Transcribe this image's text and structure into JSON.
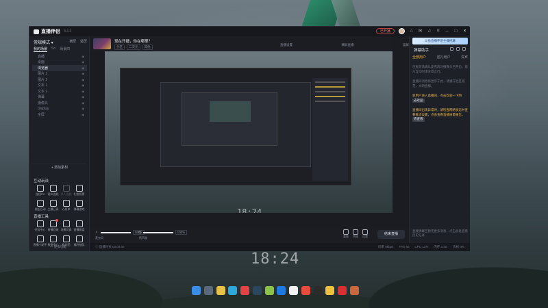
{
  "desktop": {
    "clock": "18:24",
    "taskbar_icons": [
      {
        "name": "windows-start-icon",
        "color": "#3a8ee6"
      },
      {
        "name": "taskview-icon",
        "color": "#5a6a7a"
      },
      {
        "name": "file-explorer-icon",
        "color": "#e8c14a"
      },
      {
        "name": "edge-icon",
        "color": "#2fa7d8"
      },
      {
        "name": "app-red-icon",
        "color": "#e24444"
      },
      {
        "name": "steam-icon",
        "color": "#2a475e"
      },
      {
        "name": "app-green-icon",
        "color": "#8bc34a"
      },
      {
        "name": "kugou-icon",
        "color": "#1f7ae0"
      },
      {
        "name": "app-white-icon",
        "color": "#f1f1f1"
      },
      {
        "name": "chrome-icon",
        "color": "#e84c3d"
      },
      {
        "name": "qq-icon",
        "color": "#2b2b2b"
      },
      {
        "name": "app-yellow-icon",
        "color": "#f0c040"
      },
      {
        "name": "netease-music-icon",
        "color": "#d93030"
      },
      {
        "name": "app-avatar-icon",
        "color": "#c9683c"
      }
    ]
  },
  "window": {
    "app_name": "直播伴侣",
    "version": "8.4.3",
    "live_status": "已开播",
    "accent": "#f0b84a"
  },
  "left": {
    "mode": "常规模式 ▾",
    "mode_ops": [
      "横屏",
      "竖屏"
    ],
    "scene_tabs": [
      "我的场景",
      "Sn",
      "场景四"
    ],
    "sources": [
      {
        "label": "直播",
        "active": false
      },
      {
        "label": "桌面",
        "active": false
      },
      {
        "label": "浏览器",
        "active": true
      },
      {
        "label": "图片 1",
        "active": false
      },
      {
        "label": "图片 2",
        "active": false
      },
      {
        "label": "文本 1",
        "active": false
      },
      {
        "label": "文本 2",
        "active": false
      },
      {
        "label": "弹幕",
        "active": false
      },
      {
        "label": "摄像头",
        "active": false
      },
      {
        "label": "Display",
        "active": false
      },
      {
        "label": "全屏",
        "active": false
      }
    ],
    "add_source": "+ 添加素材",
    "interact_title": "互动玩法",
    "interact_items": [
      {
        "label": "连线PK",
        "dim": false
      },
      {
        "label": "观众连线",
        "dim": false
      },
      {
        "label": "多人连线",
        "dim": true
      },
      {
        "label": "礼物投票",
        "dim": false
      },
      {
        "label": "发起互动",
        "dim": false
      },
      {
        "label": "主播已读",
        "dim": false
      },
      {
        "label": "心愿单",
        "dim": false
      },
      {
        "label": "弹幕游戏",
        "dim": false
      }
    ],
    "tools_title": "直播工具",
    "tools_items": [
      {
        "label": "任务中心",
        "dot": false
      },
      {
        "label": "直播回放",
        "dot": true
      },
      {
        "label": "场景切换",
        "dot": false
      },
      {
        "label": "直播复盘",
        "dot": false
      },
      {
        "label": "直播小助手",
        "dot": false
      },
      {
        "label": "数据中心",
        "dot": false
      },
      {
        "label": "粉丝团",
        "dot": false
      },
      {
        "label": "福利抽奖",
        "dot": false
      }
    ],
    "more_tools": "— 更多功能"
  },
  "room": {
    "title": "现在开播，你在哪里？",
    "tags": [
      "分区",
      "二次元",
      "其他"
    ]
  },
  "toolbar": {
    "left": "直播画面",
    "center": "直播设置",
    "right1": "横屏直播",
    "right2": "竖屏"
  },
  "controls": {
    "mic_label": "麦克风",
    "mic_value": "100%",
    "mic_level": 100,
    "speaker_label": "扬声器",
    "speaker_value": "100%",
    "speaker_level": 100,
    "icons": [
      "美颜",
      "特效",
      "设置"
    ],
    "go_live": "结束直播"
  },
  "status": {
    "left": "◎ 直播时长 00:00:00",
    "right": [
      "码率 0kbps",
      "FPS 60",
      "CPU 12%",
      "内存 3.4G",
      "丢帧 0%"
    ]
  },
  "right": {
    "promo": "斗鱼直播伴侣主播招募",
    "panel_title": "弹幕助手",
    "tabs": [
      "全部用户",
      "送礼用户",
      "贵宾"
    ],
    "messages": [
      {
        "text": "连麦前请确认麦克风与摄像头已开启，观众互动时请注意言行。",
        "hl": false
      },
      {
        "text": "直播间消息将显示于此，请遵守社区规范，文明直播。",
        "hl": false
      },
      {
        "text": "新用户进入直播间，点击欢迎一下吧",
        "hl": true,
        "chip": "去欢迎"
      },
      {
        "text": "直播间出现异常时，请检查网络状态并查看推流设置，点击查看直播质量报告。",
        "hl": true,
        "chip": "去查看"
      }
    ],
    "bottom": "直播弹幕区暂无更多消息，点击此处查看历史记录"
  }
}
